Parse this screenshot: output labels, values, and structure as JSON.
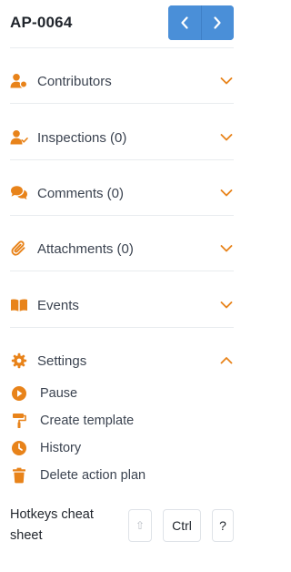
{
  "header": {
    "plan_id": "AP-0064",
    "prev_icon": "chevron-left-icon",
    "next_icon": "chevron-right-icon"
  },
  "colors": {
    "accent": "#e8831a",
    "nav_button": "#4a8fd8",
    "text": "#3b4350",
    "divider": "#e9ecef"
  },
  "sections": [
    {
      "label": "Contributors",
      "icon": "users-icon",
      "expanded": false
    },
    {
      "label": "Inspections (0)",
      "icon": "user-check-icon",
      "expanded": false
    },
    {
      "label": "Comments (0)",
      "icon": "comments-icon",
      "expanded": false
    },
    {
      "label": "Attachments (0)",
      "icon": "paperclip-icon",
      "expanded": false
    },
    {
      "label": "Events",
      "icon": "book-icon",
      "expanded": false
    },
    {
      "label": "Settings",
      "icon": "gear-icon",
      "expanded": true
    }
  ],
  "settings_actions": [
    {
      "label": "Pause",
      "icon": "pause-circle-icon"
    },
    {
      "label": "Create template",
      "icon": "paint-roller-icon"
    },
    {
      "label": "History",
      "icon": "clock-icon"
    },
    {
      "label": "Delete action plan",
      "icon": "trash-icon"
    }
  ],
  "hotkeys": {
    "label": "Hotkeys cheat sheet",
    "keys": [
      "⇧",
      "Ctrl",
      "?"
    ]
  }
}
